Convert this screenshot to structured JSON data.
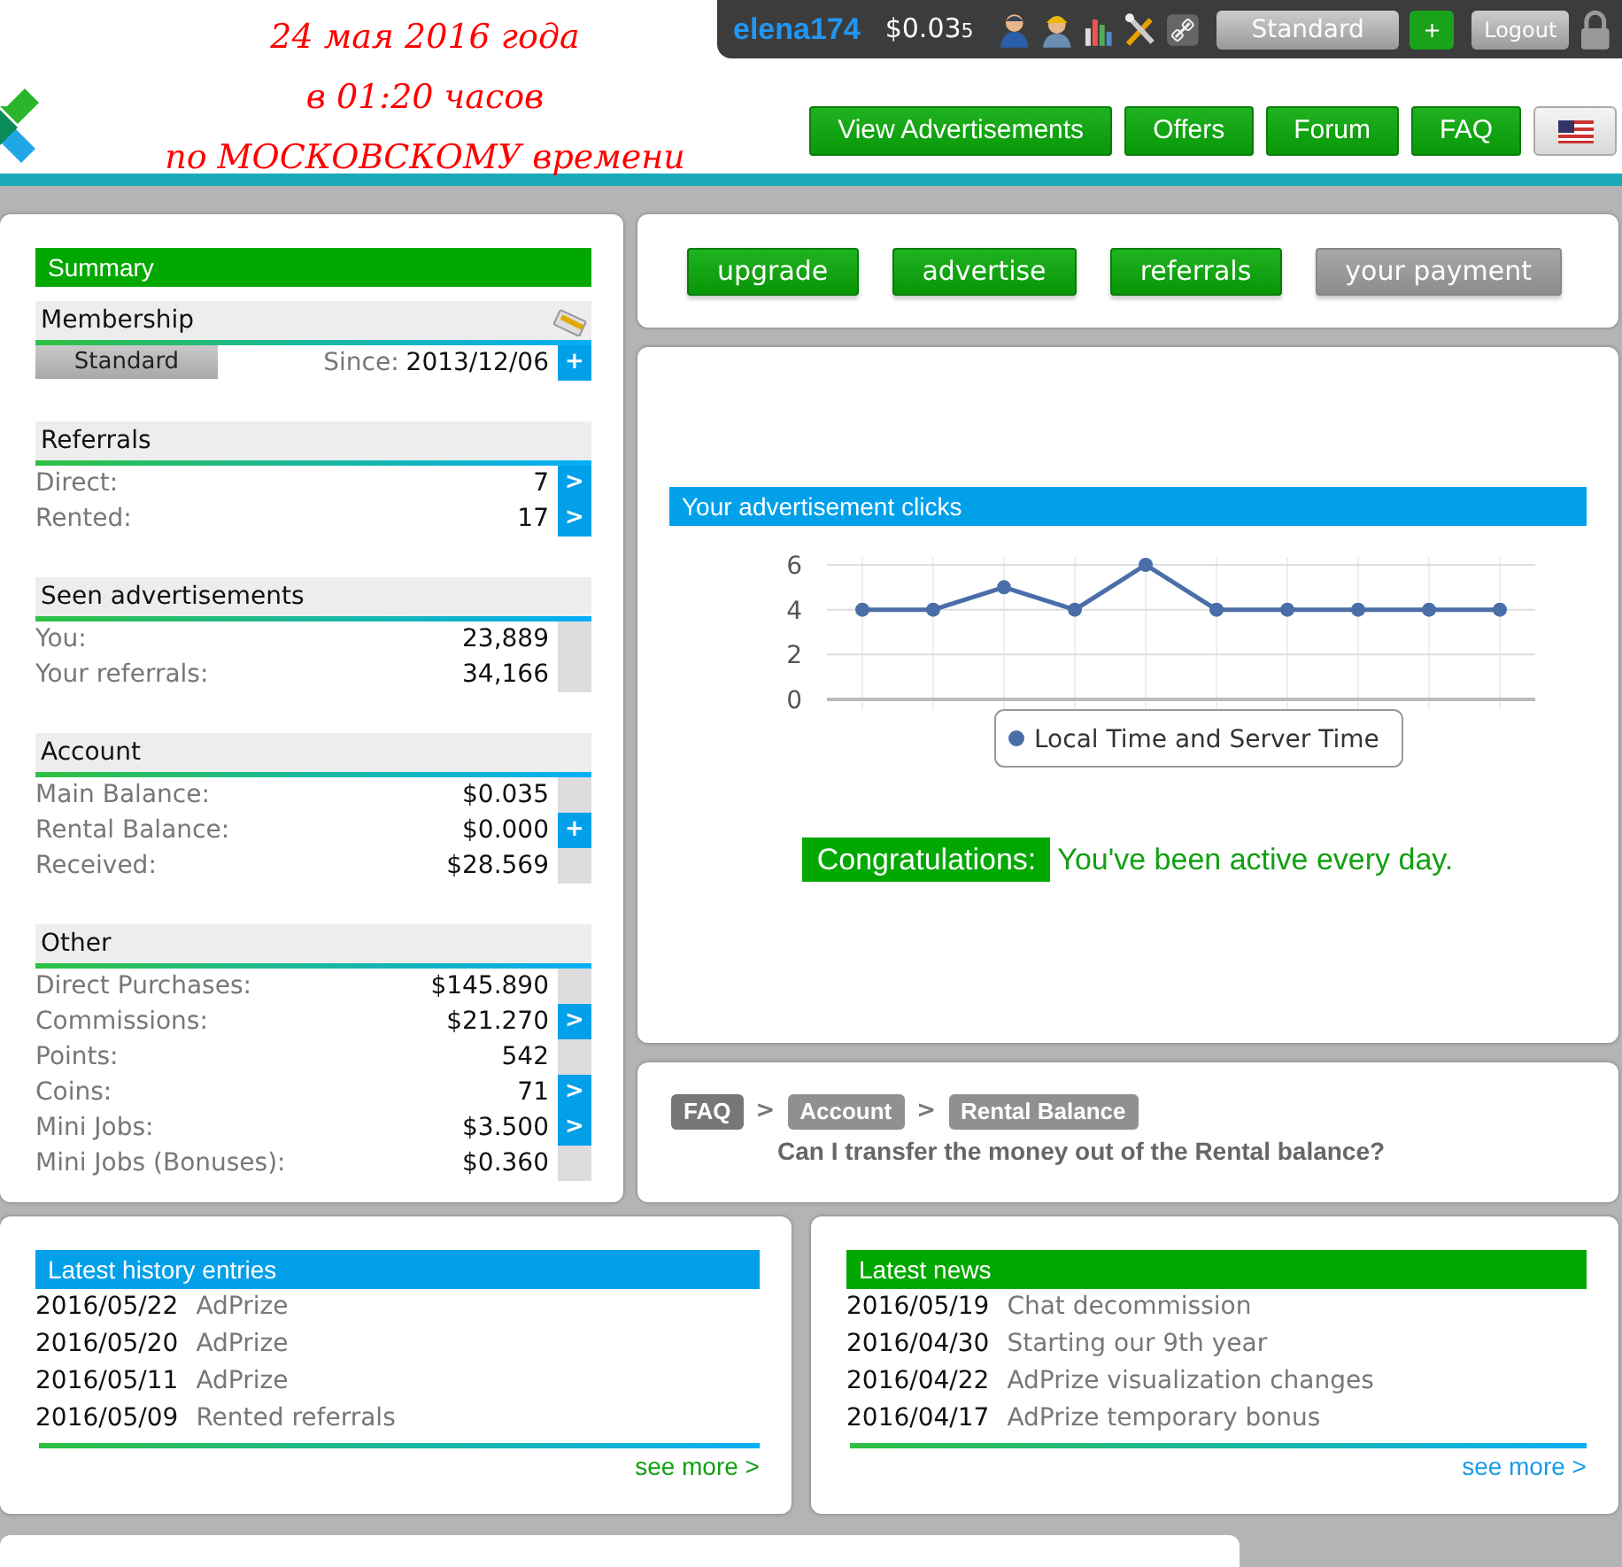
{
  "annotation": [
    "24 мая 2016 года",
    "в 01:20 часов",
    "по МОСКОВСКОМУ времени"
  ],
  "user_bar": {
    "username": "elena174",
    "balance": "$0.03$_{5}$",
    "membership": "Standard",
    "add": "+",
    "logout": "Logout"
  },
  "nav": [
    "View Advertisements",
    "Offers",
    "Forum",
    "FAQ"
  ],
  "summary": {
    "title": "Summary",
    "membership": {
      "title": "Membership",
      "level": "Standard",
      "since_label": "Since:",
      "since": "2013/12/06",
      "action": "+"
    },
    "sections": [
      {
        "title": "Referrals",
        "rows": [
          {
            "label": "Direct:",
            "value": "7",
            "action": ">"
          },
          {
            "label": "Rented:",
            "value": "17",
            "action": ">"
          }
        ]
      },
      {
        "title": "Seen advertisements",
        "rows": [
          {
            "label": "You:",
            "value": "23,889"
          },
          {
            "label": "Your referrals:",
            "value": "34,166"
          }
        ]
      },
      {
        "title": "Account",
        "rows": [
          {
            "label": "Main Balance:",
            "value": "$0.035"
          },
          {
            "label": "Rental Balance:",
            "value": "$0.000",
            "action": "+"
          },
          {
            "label": "Received:",
            "value": "$28.569"
          }
        ]
      },
      {
        "title": "Other",
        "rows": [
          {
            "label": "Direct Purchases:",
            "value": "$145.890"
          },
          {
            "label": "Commissions:",
            "value": "$21.270",
            "action": ">"
          },
          {
            "label": "Points:",
            "value": "542"
          },
          {
            "label": "Coins:",
            "value": "71",
            "action": ">"
          },
          {
            "label": "Mini Jobs:",
            "value": "$3.500",
            "action": ">"
          },
          {
            "label": "Mini Jobs (Bonuses):",
            "value": "$0.360"
          }
        ]
      }
    ]
  },
  "actions": [
    {
      "label": "upgrade",
      "disabled": false
    },
    {
      "label": "advertise",
      "disabled": false
    },
    {
      "label": "referrals",
      "disabled": false
    },
    {
      "label": "your payment",
      "disabled": true
    }
  ],
  "clicks": {
    "title": "Your advertisement clicks",
    "chart_data": {
      "type": "line",
      "grid": true,
      "series": [
        {
          "name": "Local Time and Server Time",
          "color": "#4a6ea8",
          "marker": true,
          "values": [
            4,
            4,
            5,
            4,
            6,
            4,
            4,
            4,
            4,
            4
          ]
        }
      ],
      "ylim": [
        0,
        6
      ],
      "yticks": [
        0,
        2,
        4,
        6
      ]
    },
    "badge": "Congratulations:",
    "message": "You've been active every day."
  },
  "faq": {
    "breadcrumb": [
      "FAQ",
      "Account",
      "Rental Balance"
    ],
    "separator": ">",
    "question": "Can I transfer the money out of the Rental balance?"
  },
  "history": {
    "title": "Latest history entries",
    "entries": [
      {
        "date": "2016/05/22",
        "text": "AdPrize"
      },
      {
        "date": "2016/05/20",
        "text": "AdPrize"
      },
      {
        "date": "2016/05/11",
        "text": "AdPrize"
      },
      {
        "date": "2016/05/09",
        "text": "Rented referrals"
      }
    ],
    "more": "see more >"
  },
  "news": {
    "title": "Latest news",
    "entries": [
      {
        "date": "2016/05/19",
        "text": "Chat decommission"
      },
      {
        "date": "2016/04/30",
        "text": "Starting our 9th year"
      },
      {
        "date": "2016/04/22",
        "text": "AdPrize visualization changes"
      },
      {
        "date": "2016/04/17",
        "text": "AdPrize temporary bonus"
      }
    ],
    "more": "see more >"
  }
}
